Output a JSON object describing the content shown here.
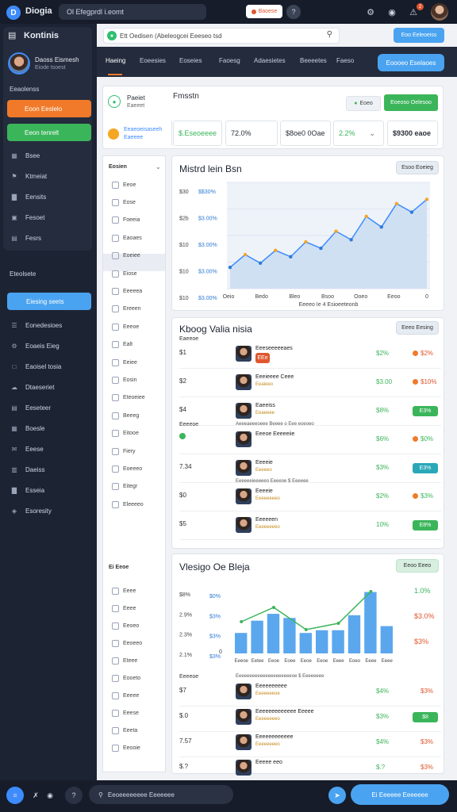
{
  "topbar": {
    "logo_letter": "D",
    "app_name": "Diogia",
    "url": "Ol Efegprdl i.eomt",
    "pill": "Baoese",
    "help": "?",
    "icons": [
      "bell-icon",
      "settings-icon",
      "notification-icon"
    ],
    "notif_count": "2"
  },
  "sidebar": {
    "title": "Kontinis",
    "user_name": "Daoss Eismesh",
    "user_sub": "Eiode tsoest",
    "section1": "Eeaolenss",
    "btn_orange": "Eoon Eeslelo",
    "btn_green": "Eeon tenrelt",
    "items1": [
      {
        "icon": "grid-icon",
        "label": "Bsee"
      },
      {
        "icon": "tag-icon",
        "label": "Ktmeiat"
      },
      {
        "icon": "chart-icon",
        "label": "Eensits"
      },
      {
        "icon": "box-icon",
        "label": "Fesoet"
      },
      {
        "icon": "folder-icon",
        "label": "Fesrs"
      }
    ],
    "section2": "Eteolsete",
    "active": "Eiesing seets",
    "items2": [
      {
        "icon": "list-icon",
        "label": "Eonedesioes"
      },
      {
        "icon": "gear-icon",
        "label": "Eoaeis Eieg"
      },
      {
        "icon": "doc-icon",
        "label": "Eaoisel tosia"
      },
      {
        "icon": "cloud-icon",
        "label": "Dtaeseriet"
      },
      {
        "icon": "table-icon",
        "label": "Eeseteer"
      },
      {
        "icon": "calendar-icon",
        "label": "Boesle"
      },
      {
        "icon": "mail-icon",
        "label": "Eeese"
      },
      {
        "icon": "stack-icon",
        "label": "Daeiss"
      },
      {
        "icon": "chart-icon",
        "label": "Esseia"
      },
      {
        "icon": "pin-icon",
        "label": "Esoresity"
      }
    ]
  },
  "main": {
    "search": "Ett Oedisen (Abeleogcei Eeeseo tsd",
    "top_btn": "Eoo Eeleoeiss",
    "tabs": [
      "Haeing",
      "Eoeesies",
      "Eoseies",
      "Faoesg",
      "Adaesietes",
      "Beeeetes",
      "Faeso"
    ],
    "nav_btn": "Eoooeo Eselaoes"
  },
  "summary": {
    "name": "Paeiet",
    "sub": "Eaeeet",
    "title": "Fmsstn",
    "label1": "Eeaeoeisaseeh",
    "label2": "Eaeeee",
    "btn_light": "Eoeo",
    "btn_green": "Eoeoso Oelesoo",
    "cells": [
      "$.Eseoeeee",
      "72.0%",
      "$8oe0 0Oae",
      "2.2%",
      "$9300 eaoe"
    ]
  },
  "list_panel": {
    "head1": "Eosien",
    "items1": [
      "Eeoe",
      "Eose",
      "Foeeia",
      "Eaoaes",
      "Eoeiee",
      "Eiose",
      "Eeeeea",
      "Ereeen",
      "Eeeoe",
      "Ealt",
      "Eeiee",
      "Eosin",
      "Eteoeiee",
      "Beeeg",
      "Eitooe",
      "Fiery",
      "Eoeeeo",
      "Eitegr",
      "Eleeeeo"
    ],
    "head2": "Ei Eeoe",
    "items2": [
      "Eeee",
      "Eeee",
      "Eeoeo",
      "Eeoeeo",
      "Eteee",
      "Eooeto",
      "Eeeee",
      "Eeese",
      "Eeeta",
      "Eeooie"
    ]
  },
  "chart1": {
    "title": "Mistrd lein Bsn",
    "btn": "Esoo Eoeieg",
    "ytick_labels_left": [
      "$30",
      "$2b",
      "$10",
      "$10",
      "$10"
    ],
    "ytick_labels_blue": [
      "$$30%",
      "$3.00%",
      "$3.00%",
      "$3.00%",
      "$3.00%"
    ],
    "xlabel": "Eeeeo Ie 4 Esioeeteonb"
  },
  "chart_data": [
    {
      "type": "line",
      "title": "Mistrd lein Bsn",
      "x": [
        "Oeio",
        "Bedo",
        "Bleo",
        "Bsoo",
        "Ooeo",
        "Eeoo",
        "0"
      ],
      "series": [
        {
          "values": [
            10,
            16,
            12,
            18,
            15,
            22,
            19,
            27,
            23,
            34,
            29,
            40,
            36,
            42
          ]
        }
      ],
      "ylim": [
        0,
        50
      ],
      "grid": true
    },
    {
      "type": "bar",
      "title": "Vlesigo Oe Bleja",
      "categories": [
        "Eeeoe",
        "Eetee",
        "Eeoe",
        "Eoee",
        "Eeoe",
        "Eeoe",
        "Eeee",
        "Eoeo",
        "Eeee",
        "Eeee"
      ],
      "values": [
        30,
        48,
        58,
        52,
        30,
        34,
        34,
        56,
        90,
        40
      ],
      "ylim": [
        0,
        100
      ]
    }
  ],
  "table1": {
    "title": "Kboog Valia nisia",
    "btn": "Eeeo Eesing",
    "rows": [
      {
        "left_top": "Eaeeoe",
        "left": "$1",
        "name": "Eeeseeeeeaes",
        "tag": "EEe",
        "tag_color": "#e0562e",
        "value": "$2%",
        "change": "$2%",
        "change_color": "#e0562e",
        "change_dot": "#f07a2a"
      },
      {
        "left": "$2",
        "name": "Eeeieeee Ceee",
        "sub": "Eeaieeo",
        "value": "$3.00",
        "change": "$10%",
        "change_color": "#e0562e",
        "change_dot": "#f07a2a"
      },
      {
        "left": "$4",
        "name": "Eaeeiss",
        "sub": "Eeaeeee",
        "value": "$8%",
        "change": "$3%",
        "change_color": "#3bb55a",
        "tag": "E3%",
        "tag_color": "#3bb55a"
      },
      {
        "left_top": "Eeeeoe",
        "left_dot": "#3bb55a",
        "name": "Eeeoe Eeeeeiie",
        "header": "Aeeeaeeeoeee Beeee o Eee eoeoeo",
        "value": "$6%",
        "change": "$0%",
        "change_color": "#3bb55a",
        "change_dot": "#f07a2a"
      },
      {
        "left": "7.34",
        "name": "Eeeeie",
        "sub": "Eeeeeo",
        "value": "$3%",
        "change": "$3%",
        "change_color": "#fff",
        "tag": "E3%",
        "tag_color": "#2aa8b8"
      },
      {
        "left": "$0",
        "header": "Eeeeeeieeeeeo Eeeeoe $ Eeeeee",
        "name": "Eeeeie",
        "sub": "Eeeeeeeeo",
        "value": "$2%",
        "change": "$3%",
        "change_color": "#3bb55a",
        "change_dot": "#f07a2a"
      },
      {
        "left": "$5",
        "name": "Eeeeeen",
        "sub": "Eeeeeeeeo",
        "value": "10%",
        "change": "$8%",
        "change_color": "#fff",
        "tag": "E8%",
        "tag_color": "#3bb55a"
      }
    ]
  },
  "chart2": {
    "title": "Vlesigo Oe Bleja",
    "btn": "Eeoo Eeeo",
    "ytick_left": [
      "$8%",
      "2.9%",
      "2.3%",
      "2.1%"
    ],
    "ytick_blue": [
      "$0%",
      "$3%",
      "$3%",
      "$3%"
    ],
    "right_labels": [
      "1.0%",
      "$3.0%",
      "$3%"
    ],
    "right_colors": [
      "#3bb55a",
      "#e0562e",
      "#e0562e"
    ],
    "zero": "0",
    "rows": [
      {
        "left_top": "Eeeeoe",
        "header": "Eeeeeeeeeeeeeeeeeeeeeoe $ Eeeeeeee",
        "left": "$7",
        "name": "Eeeeeeeeee",
        "sub": "Eeeeeeeoe",
        "value": "$4%",
        "change": "$3%",
        "change_color": "#e0562e"
      },
      {
        "left": "$.0",
        "name": "Eeeeeeeeeeeee Eeeee",
        "sub": "Eeeeeeeeo",
        "value": "$3%",
        "change": "$3%",
        "change_color": "#e0562e",
        "tag": "$8",
        "tag_color": "#3bb55a"
      },
      {
        "left": "7.57",
        "name": "Eeeeeeeeeeee",
        "sub": "Eeeeeeeeo",
        "value": "$4%",
        "change": "$3%",
        "change_color": "#e0562e"
      },
      {
        "left": "$.?",
        "name": "Eeeee eeo",
        "sub": "",
        "value": "$.?",
        "change": "$3%",
        "change_color": "#e0562e"
      }
    ]
  },
  "bottombar": {
    "input": "Eeoeeeeeeee Eeeeeee",
    "btn": "Ei Eeeeee Eeeeeee"
  }
}
